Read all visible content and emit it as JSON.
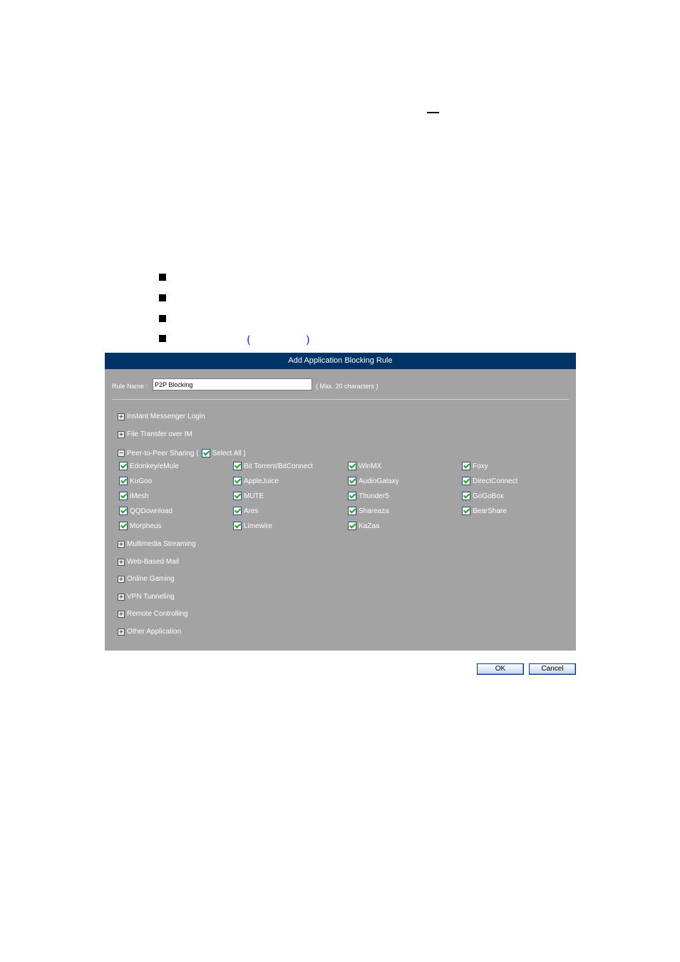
{
  "doc": {
    "dash": "—",
    "paren_open": "(",
    "paren_close": ")"
  },
  "dialog": {
    "title": "Add Application Blocking Rule",
    "rule_name_label": "Rule Name :",
    "rule_name_value": "P2P Blocking",
    "rule_name_hint": "( Max. 20 characters )",
    "categories_top": [
      {
        "label": "Instant Messenger Login",
        "expander": "+"
      },
      {
        "label": "File Transfer over IM",
        "expander": "+"
      }
    ],
    "p2p": {
      "label": "Peer-to-Peer Sharing (",
      "expander": "−",
      "select_all": "Select All )",
      "apps": [
        [
          "Edonkey/eMule",
          "Bit Torrent/BitConnect",
          "WinMX",
          "Foxy"
        ],
        [
          "KuGoo",
          "AppleJuice",
          "AudioGalaxy",
          "DirectConnect"
        ],
        [
          "iMesh",
          "MUTE",
          "Thunder5",
          "GoGoBox"
        ],
        [
          "QQDownload",
          "Ares",
          "Shareaza",
          "BearShare"
        ],
        [
          "Morpheus",
          "Limewire",
          "KaZaa"
        ]
      ]
    },
    "categories_bottom": [
      {
        "label": "Multimedia Streaming",
        "expander": "+"
      },
      {
        "label": "Web-Based Mail",
        "expander": "+"
      },
      {
        "label": "Online Gaming",
        "expander": "+"
      },
      {
        "label": "VPN Tunneling",
        "expander": "+"
      },
      {
        "label": "Remote Controlling",
        "expander": "+"
      },
      {
        "label": "Other Application",
        "expander": "+"
      }
    ]
  },
  "buttons": {
    "ok": "OK",
    "cancel": "Cancel"
  }
}
